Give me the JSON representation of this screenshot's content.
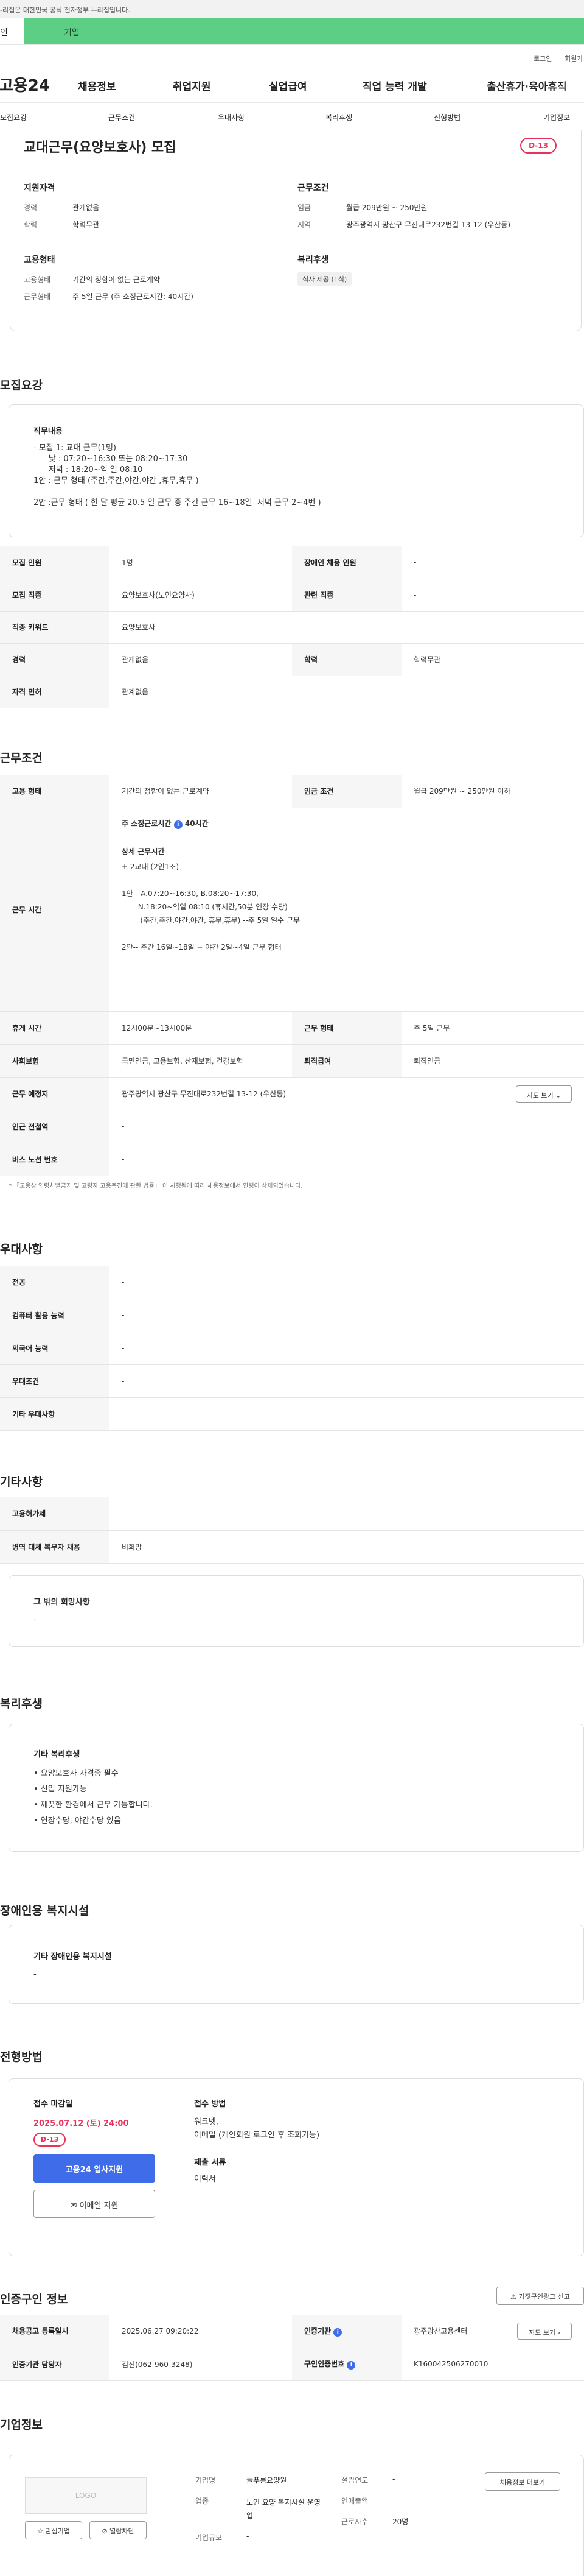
{
  "gov_bar": "-리집은 대한민국 공식 전자정부 누리집입니다.",
  "top_tabs": [
    "인",
    "기업"
  ],
  "util": [
    "로그인",
    "회원가"
  ],
  "nav": {
    "logo": "고용24",
    "items": [
      "채용정보",
      "취업지원",
      "실업급여",
      "직업 능력 개발",
      "출산휴가·육아휴직"
    ]
  },
  "subnav": [
    "모집요강",
    "근무조건",
    "우대사항",
    "복리후생",
    "전형방법",
    "기업정보"
  ],
  "summary": {
    "title": "교대근무(요양보호사) 모집",
    "dday": "D-13",
    "qual_h": "지원자격",
    "qual": [
      {
        "k": "경력",
        "v": "관계없음"
      },
      {
        "k": "학력",
        "v": "학력무관"
      }
    ],
    "cond_h": "근무조건",
    "cond": [
      {
        "k": "임금",
        "v": "월급 209만원 ~ 250만원"
      },
      {
        "k": "지역",
        "v": "광주광역시 광산구 무진대로232번길 13-12 (우산동)"
      }
    ],
    "emp_h": "고용형태",
    "emp": [
      {
        "k": "고용형태",
        "v": "기간의 정함이 없는 근로계약"
      },
      {
        "k": "근무형태",
        "v": "주 5일 근무 (주 소정근로시간: 40시간)"
      }
    ],
    "welfare_h": "복리후생",
    "welfare_tag": "식사 제공 (1식)"
  },
  "recruit": {
    "title": "모집요강",
    "duty_h": "직무내용",
    "duty_text": "- 모집 1: 교대 근무(1명)\n      낮 : 07:20~16:30 또는 08:20~17:30\n      저녁 : 18:20~익 일 08:10\n1안 : 근무 형태 (주간,주간,야간,야간 ,휴무,휴무 )\n\n2안 :근무 형태 ( 한 달 평균 20.5 일 근무 중 주간 근무 16~18일  저녁 근무 2~4번 )",
    "rows": [
      {
        "k1": "모집 인원",
        "v1": "1명",
        "k2": "장애인 채용 인원",
        "v2": "-"
      },
      {
        "k1": "모집 직종",
        "v1": "요양보호사(노인요양사)",
        "k2": "관련 직종",
        "v2": "-"
      },
      {
        "k1": "직종 키워드",
        "v1": "요양보호사"
      },
      {
        "k1": "경력",
        "v1": "관계없음",
        "k2": "학력",
        "v2": "학력무관"
      },
      {
        "k1": "자격 면허",
        "v1": "관계없음"
      }
    ]
  },
  "work": {
    "title": "근무조건",
    "emp_k": "고용 형태",
    "emp_v": "기간의 정함이 없는 근로계약",
    "wage_k": "임금 조건",
    "wage_v": "월급 209만원 ~ 250만원 이하",
    "time_k": "근무 시간",
    "time_weekly": "주 소정근로시간",
    "time_hours": "40시간",
    "time_detail_h": "상세 근무시간",
    "time_detail": "+ 2교대 (2인1조)\n\n1안 --A.07:20~16:30, B.08:20~17:30,\n       N.18:20~익일 08:10 (휴시간,50분 연장 수당)\n        (주간,주간,야간,야간, 휴무,휴무) --주 5일 일수 근무\n\n2안-- 주간 16일~18일 + 야간 2일~4일 근무 형태",
    "rows": [
      {
        "k1": "휴게 시간",
        "v1": "12시00분~13시00분",
        "k2": "근무 형태",
        "v2": "주 5일 근무"
      },
      {
        "k1": "사회보험",
        "v1": "국민연금, 고용보험, 산재보험, 건강보험",
        "k2": "퇴직급여",
        "v2": "퇴직연금"
      }
    ],
    "loc_k": "근무 예정지",
    "loc_v": "광주광역시 광산구 무진대로232번길 13-12 (우산동)",
    "map_btn": "지도 보기",
    "station_k": "인근 전철역",
    "station_v": "-",
    "bus_k": "버스 노선 번호",
    "bus_v": "-",
    "note": "* 「고용상 연령차별금지 및 고령자 고용촉진에 관한 법률」 이 시행됨에 따라 채용정보에서 연령이 삭제되었습니다."
  },
  "pref": {
    "title": "우대사항",
    "rows": [
      {
        "k": "전공",
        "v": "-"
      },
      {
        "k": "컴퓨터 활용 능력",
        "v": "-"
      },
      {
        "k": "외국어 능력",
        "v": "-"
      },
      {
        "k": "우대조건",
        "v": "-"
      },
      {
        "k": "기타 우대사항",
        "v": "-"
      }
    ]
  },
  "etc": {
    "title": "기타사항",
    "rows": [
      {
        "k": "고용허가제",
        "v": "-"
      },
      {
        "k": "병역 대체 복무자 채용",
        "v": "비희망"
      }
    ],
    "other_h": "그 밖의 희망사항",
    "other_v": "-"
  },
  "welfare": {
    "title": "복리후생",
    "h": "기타 복리후생",
    "items": [
      "• 요양보호사 자격증 필수",
      "• 신입 지원가능",
      "• 깨끗한 환경에서 근무 가능합니다.",
      "• 연장수당, 야간수당 있음"
    ]
  },
  "disabled": {
    "title": "장애인용 복지시설",
    "h": "기타 장애인용 복지시설",
    "v": "-"
  },
  "process": {
    "title": "전형방법",
    "deadline_h": "접수 마감일",
    "deadline": "2025.07.12 (토) 24:00",
    "dday": "D-13",
    "apply_btn": "고용24 입사지원",
    "email_btn": "이메일 지원",
    "method_h": "접수 방법",
    "method": "워크넷,\n이메일 (개인회원 로그인 후 조회가능)",
    "docs_h": "제출 서류",
    "docs": "이력서"
  },
  "cert": {
    "title": "인증구인 정보",
    "report_btn": "거짓구인광고 신고",
    "rows": [
      {
        "k1": "채용공고 등록일시",
        "v1": "2025.06.27 09:20:22",
        "k2": "인증기관",
        "v2": "광주광산고용센터",
        "btn": "지도 보기"
      },
      {
        "k1": "인증기관 담당자",
        "v1": "김진(062-960-3248)",
        "k2": "구인인증번호",
        "v2": "K160042506270010"
      }
    ]
  },
  "company": {
    "title": "기업정보",
    "logo": "LOGO",
    "fav_btn": "관심기업",
    "block_btn": "열람차단",
    "fields": [
      {
        "k": "기업명",
        "v": "늘푸름요양원"
      },
      {
        "k": "업종",
        "v": "노인 요양 복지시설 운영업"
      },
      {
        "k": "기업규모",
        "v": "-"
      },
      {
        "k": "설립연도",
        "v": "-"
      },
      {
        "k": "연매출액",
        "v": "-"
      },
      {
        "k": "근로자수",
        "v": "20명"
      }
    ],
    "jobs_btn": "채용정보 더보기"
  }
}
